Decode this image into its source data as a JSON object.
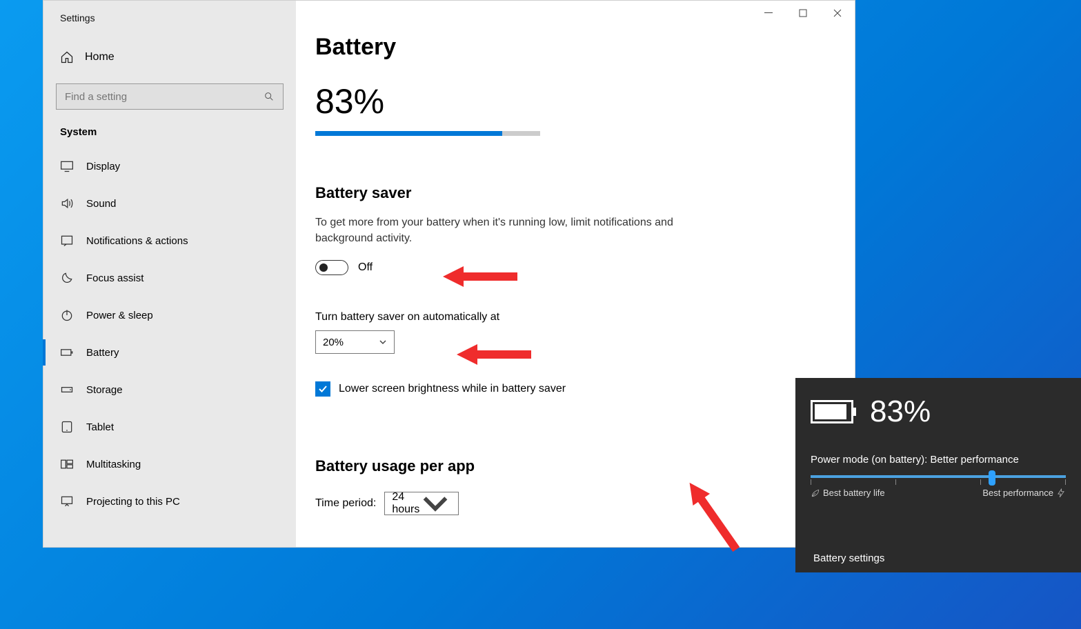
{
  "window": {
    "app_title": "Settings",
    "home_label": "Home",
    "search_placeholder": "Find a setting",
    "section_label": "System",
    "nav": [
      {
        "label": "Display"
      },
      {
        "label": "Sound"
      },
      {
        "label": "Notifications & actions"
      },
      {
        "label": "Focus assist"
      },
      {
        "label": "Power & sleep"
      },
      {
        "label": "Battery"
      },
      {
        "label": "Storage"
      },
      {
        "label": "Tablet"
      },
      {
        "label": "Multitasking"
      },
      {
        "label": "Projecting to this PC"
      }
    ]
  },
  "main": {
    "title": "Battery",
    "battery_percent": "83%",
    "battery_fill_percent": 83,
    "saver_heading": "Battery saver",
    "saver_desc": "To get more from your battery when it's running low, limit notifications and background activity.",
    "toggle_state": "Off",
    "auto_label": "Turn battery saver on automatically at",
    "auto_value": "20%",
    "brightness_check_label": "Lower screen brightness while in battery saver",
    "brightness_checked": true,
    "usage_heading": "Battery usage per app",
    "period_label": "Time period:",
    "period_value": "24 hours"
  },
  "flyout": {
    "percent": "83%",
    "mode_line": "Power mode (on battery): Better performance",
    "left_label": "Best battery life",
    "right_label": "Best performance",
    "link": "Battery settings"
  }
}
